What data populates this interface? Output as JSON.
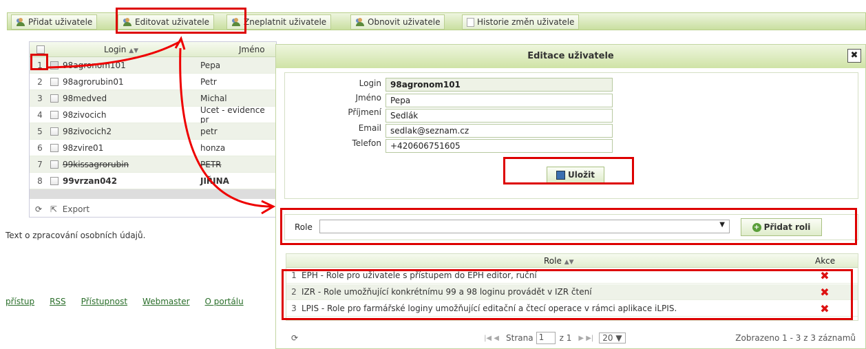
{
  "toolbar": {
    "add_user": "Přidat uživatele",
    "edit_user": "Editovat uživatele",
    "invalidate_user": "Zneplatnit uživatele",
    "restore_user": "Obnovit uživatele",
    "history": "Historie změn uživatele"
  },
  "grid": {
    "col_login": "Login",
    "col_name": "Jméno",
    "sort_icon": "sort-arrows-icon",
    "rows": [
      {
        "num": "1",
        "login": "98agronom101",
        "name": "Pepa"
      },
      {
        "num": "2",
        "login": "98agrorubin01",
        "name": "Petr"
      },
      {
        "num": "3",
        "login": "98medved",
        "name": "Michal"
      },
      {
        "num": "4",
        "login": "98zivocich",
        "name": "Ucet - evidence pr"
      },
      {
        "num": "5",
        "login": "98zivocich2",
        "name": "petr"
      },
      {
        "num": "6",
        "login": "98zvire01",
        "name": "honza"
      },
      {
        "num": "7",
        "login": "99kissagrorubin",
        "name": "PETR"
      },
      {
        "num": "8",
        "login": "99vrzan042",
        "name": "JIŘINA"
      }
    ],
    "export_label": "Export"
  },
  "privacy_text": "Text o zpracování osobních údajů.",
  "footer": {
    "links": [
      "přístup",
      "RSS",
      "Přístupnost",
      "Webmaster",
      "O portálu"
    ]
  },
  "dialog": {
    "title": "Editace uživatele",
    "close": "✖",
    "form": {
      "login_label": "Login",
      "login_value": "98agronom101",
      "name_label": "Jméno",
      "name_value": "Pepa",
      "surname_label": "Příjmení",
      "surname_value": "Sedlák",
      "email_label": "Email",
      "email_value": "sedlak@seznam.cz",
      "phone_label": "Telefon",
      "phone_value": "+420606751605"
    },
    "save_button": "Uložit",
    "role_label": "Role",
    "role_select_value": "",
    "add_role_button": "Přidat roli",
    "roles_table": {
      "col_role": "Role",
      "col_actions": "Akce",
      "rows": [
        {
          "num": "1",
          "role": "EPH - Role pro uživatele s přístupem do EPH editor, ruční"
        },
        {
          "num": "2",
          "role": "IZR - Role umožňující konkrétnímu 99 a 98 loginu provádět v IZR čtení"
        },
        {
          "num": "3",
          "role": "LPIS - Role pro farmářské loginy umožňující editační a čtecí operace v rámci aplikace iLPIS."
        }
      ]
    },
    "pager": {
      "page_label": "Strana",
      "page_value": "1",
      "of_label": "z 1",
      "page_size": "20",
      "summary": "Zobrazeno 1 - 3 z 3 záznamů"
    }
  },
  "colors": {
    "highlight": "#dd0000",
    "accent_green": "#c9dfa0"
  }
}
